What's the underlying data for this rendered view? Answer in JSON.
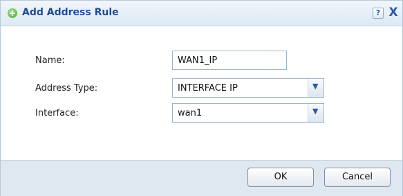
{
  "dialog": {
    "title": "Add Address Rule",
    "title_icon": "add-circle-icon",
    "help_label": "?",
    "close_label": "X"
  },
  "form": {
    "name_label": "Name:",
    "name_value": "WAN1_IP",
    "address_type_label": "Address Type:",
    "address_type_value": "INTERFACE IP",
    "interface_label": "Interface:",
    "interface_value": "wan1"
  },
  "buttons": {
    "ok_label": "OK",
    "cancel_label": "Cancel"
  },
  "colors": {
    "title_text": "#1f4e94",
    "footer_bg": "#dfe7f0",
    "accent_icon": "#49a62b"
  }
}
